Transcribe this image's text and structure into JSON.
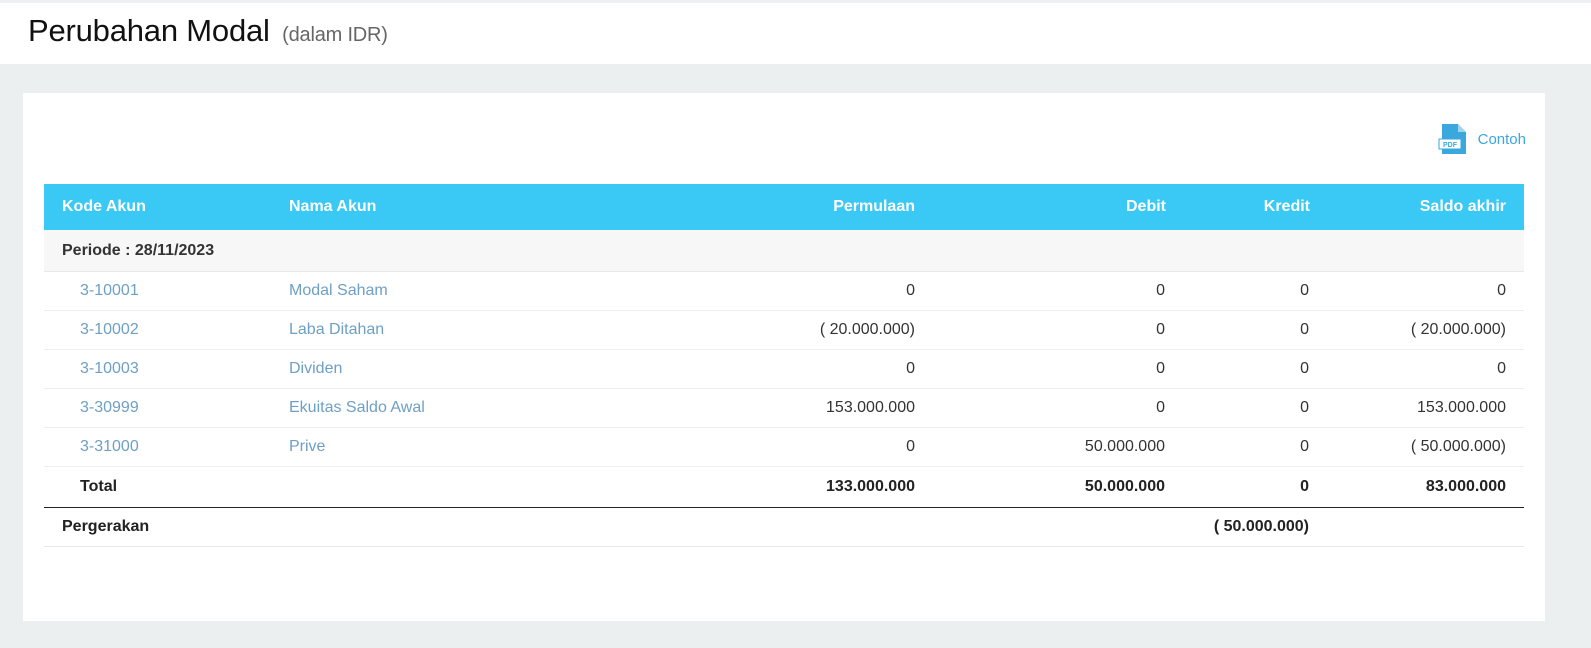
{
  "header": {
    "title": "Perubahan Modal",
    "subtitle": "(dalam IDR)"
  },
  "toolbar": {
    "export_label": "Contoh",
    "export_icon": "pdf-icon",
    "accent": "#3aa7dd"
  },
  "table": {
    "header_color": "#3ac8f5",
    "columns": [
      "Kode Akun",
      "Nama Akun",
      "Permulaan",
      "Debit",
      "Kredit",
      "Saldo akhir"
    ],
    "period_label": "Periode : 28/11/2023",
    "rows": [
      {
        "kode": "3-10001",
        "nama": "Modal Saham",
        "permulaan": "0",
        "debit": "0",
        "kredit": "0",
        "saldo": "0"
      },
      {
        "kode": "3-10002",
        "nama": "Laba Ditahan",
        "permulaan": "( 20.000.000)",
        "debit": "0",
        "kredit": "0",
        "saldo": "( 20.000.000)"
      },
      {
        "kode": "3-10003",
        "nama": "Dividen",
        "permulaan": "0",
        "debit": "0",
        "kredit": "0",
        "saldo": "0"
      },
      {
        "kode": "3-30999",
        "nama": "Ekuitas Saldo Awal",
        "permulaan": "153.000.000",
        "debit": "0",
        "kredit": "0",
        "saldo": "153.000.000"
      },
      {
        "kode": "3-31000",
        "nama": "Prive",
        "permulaan": "0",
        "debit": "50.000.000",
        "kredit": "0",
        "saldo": "( 50.000.000)"
      }
    ],
    "total": {
      "label": "Total",
      "permulaan": "133.000.000",
      "debit": "50.000.000",
      "kredit": "0",
      "saldo": "83.000.000"
    },
    "pergerakan": {
      "label": "Pergerakan",
      "value": "( 50.000.000)"
    }
  }
}
